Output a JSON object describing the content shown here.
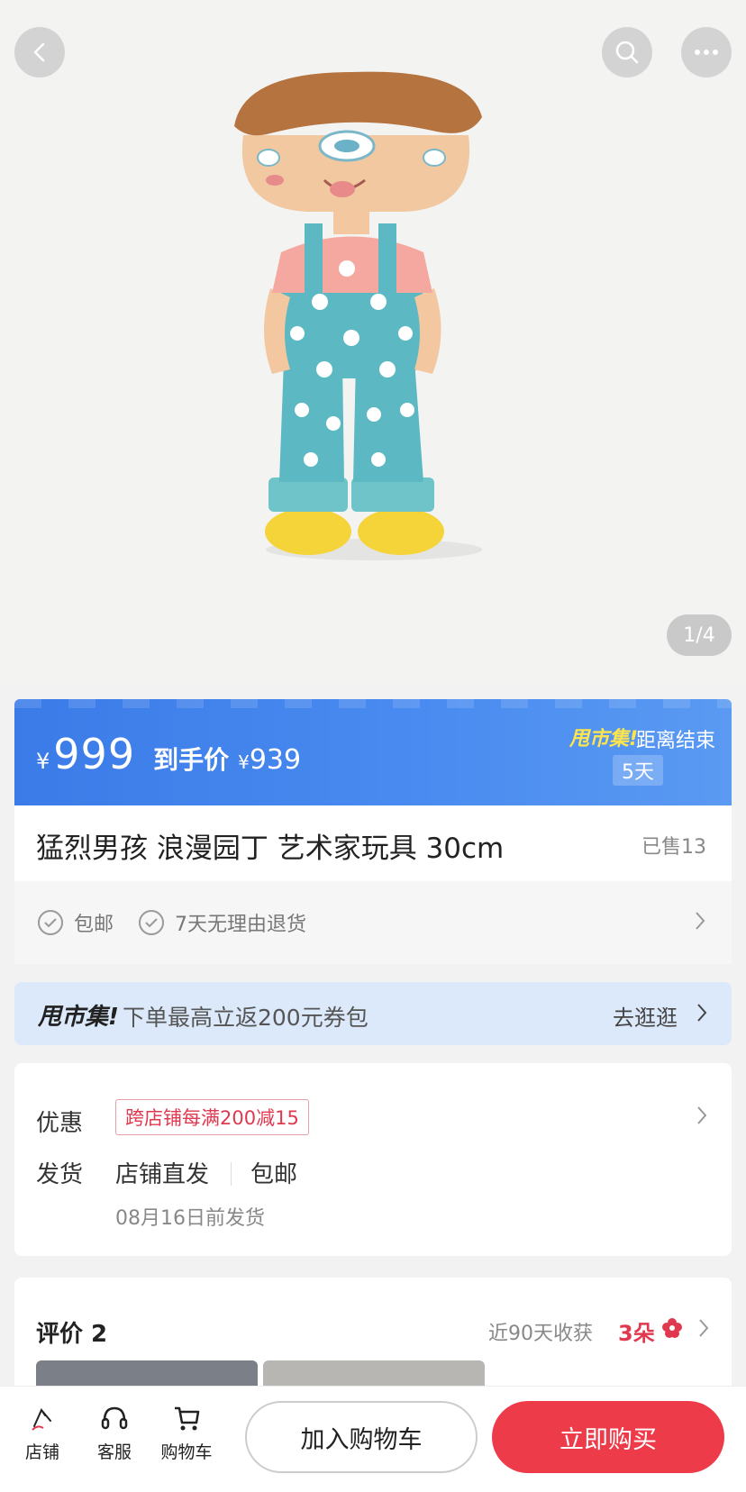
{
  "page_indicator": "1/4",
  "icons": {
    "back": "back-chevron-icon",
    "search": "search-icon",
    "more": "more-dots-icon"
  },
  "price": {
    "currency": "¥",
    "main": "999",
    "after_label": "到手价",
    "after_currency": "¥",
    "after": "939",
    "promo_brand": "甩市集!",
    "countdown_label": "距离结束",
    "countdown_days": "5天"
  },
  "product": {
    "title": "猛烈男孩 浪漫园丁 艺术家玩具 30cm",
    "sold": "已售13"
  },
  "guarantees": {
    "free_shipping": "包邮",
    "returns": "7天无理由退货"
  },
  "promo": {
    "brand": "甩市集!",
    "text": "下单最高立返200元券包",
    "link": "去逛逛"
  },
  "info": {
    "discount_label": "优惠",
    "coupon": "跨店铺每满200减15",
    "shipping_label": "发货",
    "shipping_method": "店铺直发",
    "shipping_free": "包邮",
    "shipping_date": "08月16日前发货"
  },
  "reviews": {
    "title": "评价 2",
    "harvest_text": "近90天收获",
    "harvest_count": "3朵"
  },
  "bottom_bar": {
    "store": "店铺",
    "service": "客服",
    "cart": "购物车",
    "add_to_cart": "加入购物车",
    "buy_now": "立即购买"
  },
  "colors": {
    "accent_red": "#ee3b4a",
    "banner_blue": "#3b7be8",
    "promo_yellow": "#ffe54d"
  }
}
